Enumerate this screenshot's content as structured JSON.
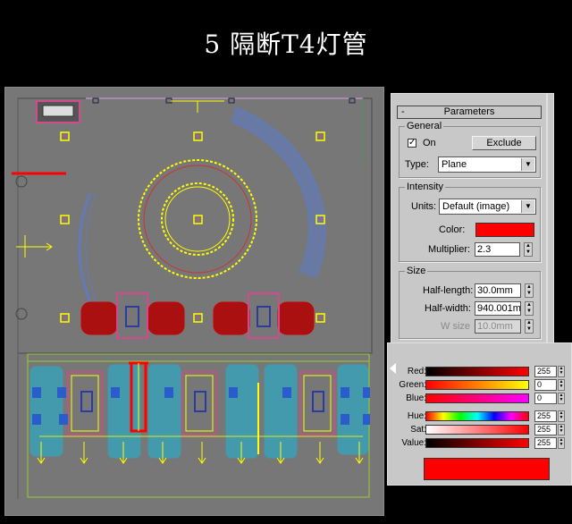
{
  "slide_title": "5  隔断T4灯管",
  "params": {
    "rollout_title": "Parameters",
    "rollout_minus": "-",
    "general": {
      "label": "General",
      "on_label": "On",
      "on_checked": true,
      "exclude_label": "Exclude",
      "type_label": "Type:",
      "type_value": "Plane"
    },
    "intensity": {
      "label": "Intensity",
      "units_label": "Units:",
      "units_value": "Default (image)",
      "color_label": "Color:",
      "color_value": "#ff0000",
      "multiplier_label": "Multiplier:",
      "multiplier_value": "2.3"
    },
    "size": {
      "label": "Size",
      "half_length_label": "Half-length:",
      "half_length_value": "30.0mm",
      "half_width_label": "Half-width:",
      "half_width_value": "940.001m",
      "w_size_label": "W size",
      "w_size_value": "10.0mm"
    }
  },
  "picker": {
    "channels": [
      {
        "label": "Red:",
        "value": "255",
        "level": 1.0
      },
      {
        "label": "Green:",
        "value": "0",
        "level": 0.0
      },
      {
        "label": "Blue:",
        "value": "0",
        "level": 0.0
      },
      {
        "label": "Hue:",
        "value": "255",
        "level": 1.0
      },
      {
        "label": "Sat:",
        "value": "255",
        "level": 1.0
      },
      {
        "label": "Value:",
        "value": "255",
        "level": 1.0
      }
    ],
    "preview_color": "#ff0000"
  },
  "colors": {
    "viewport_bg": "#777777",
    "plan_yellow": "#ffff00",
    "plan_blue": "#5c7cc8",
    "plan_cyan": "#19b7d9",
    "plan_red": "#cc0000",
    "highlight_red": "#ff0000"
  },
  "icons": {
    "checkbox": "checkmark",
    "spinner": "up-down-arrows",
    "dropdown": "chevron-down"
  }
}
